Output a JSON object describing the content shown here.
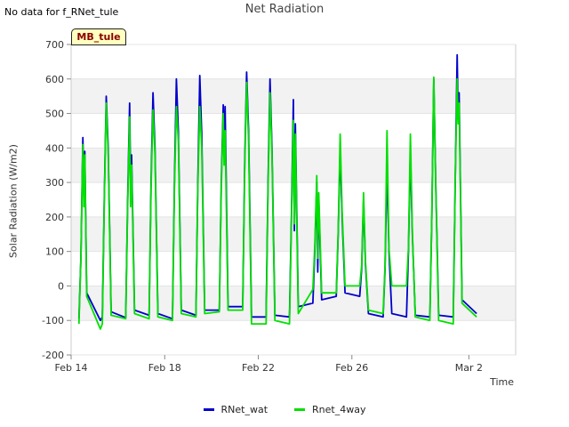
{
  "note": "No data for f_RNet_tule",
  "station_label": "MB_tule",
  "chart_data": {
    "type": "line",
    "title": "Net Radiation",
    "xlabel": "Time",
    "ylabel": "Solar Radiation (W/m2)",
    "xlim": [
      "2024-02-14",
      "2024-03-04"
    ],
    "ylim": [
      -200,
      700
    ],
    "x_ticks": [
      "Feb 14",
      "Feb 18",
      "Feb 22",
      "Feb 26",
      "Mar 2"
    ],
    "y_ticks": [
      -200,
      -100,
      0,
      100,
      200,
      300,
      400,
      500,
      600,
      700
    ],
    "grid": true,
    "legend_position": "bottom",
    "series": [
      {
        "name": "RNet_wat",
        "color": "#0000cc",
        "points": [
          [
            "2024-02-14T08:00",
            -95
          ],
          [
            "2024-02-14T10:00",
            80
          ],
          [
            "2024-02-14T12:00",
            430
          ],
          [
            "2024-02-14T13:00",
            300
          ],
          [
            "2024-02-14T14:00",
            390
          ],
          [
            "2024-02-14T16:00",
            -20
          ],
          [
            "2024-02-15T06:00",
            -100
          ],
          [
            "2024-02-15T08:00",
            -90
          ],
          [
            "2024-02-15T10:00",
            250
          ],
          [
            "2024-02-15T12:00",
            550
          ],
          [
            "2024-02-15T14:00",
            400
          ],
          [
            "2024-02-15T17:00",
            -75
          ],
          [
            "2024-02-16T08:00",
            -92
          ],
          [
            "2024-02-16T10:00",
            250
          ],
          [
            "2024-02-16T12:00",
            530
          ],
          [
            "2024-02-16T13:00",
            300
          ],
          [
            "2024-02-16T14:00",
            380
          ],
          [
            "2024-02-16T17:00",
            -70
          ],
          [
            "2024-02-17T08:00",
            -85
          ],
          [
            "2024-02-17T10:00",
            300
          ],
          [
            "2024-02-17T12:00",
            560
          ],
          [
            "2024-02-17T14:00",
            400
          ],
          [
            "2024-02-17T17:00",
            -80
          ],
          [
            "2024-02-18T08:00",
            -95
          ],
          [
            "2024-02-18T10:00",
            300
          ],
          [
            "2024-02-18T12:00",
            600
          ],
          [
            "2024-02-18T14:00",
            450
          ],
          [
            "2024-02-18T17:00",
            -70
          ],
          [
            "2024-02-19T08:00",
            -85
          ],
          [
            "2024-02-19T10:00",
            300
          ],
          [
            "2024-02-19T12:00",
            610
          ],
          [
            "2024-02-19T14:00",
            440
          ],
          [
            "2024-02-19T17:00",
            -70
          ],
          [
            "2024-02-20T08:00",
            -70
          ],
          [
            "2024-02-20T10:00",
            300
          ],
          [
            "2024-02-20T12:00",
            525
          ],
          [
            "2024-02-20T13:00",
            400
          ],
          [
            "2024-02-20T14:00",
            520
          ],
          [
            "2024-02-20T17:00",
            -60
          ],
          [
            "2024-02-21T08:00",
            -60
          ],
          [
            "2024-02-21T10:00",
            350
          ],
          [
            "2024-02-21T12:00",
            620
          ],
          [
            "2024-02-21T14:00",
            450
          ],
          [
            "2024-02-21T17:00",
            -90
          ],
          [
            "2024-02-22T08:00",
            -90
          ],
          [
            "2024-02-22T10:00",
            300
          ],
          [
            "2024-02-22T12:00",
            600
          ],
          [
            "2024-02-22T14:00",
            400
          ],
          [
            "2024-02-22T17:00",
            -85
          ],
          [
            "2024-02-23T08:00",
            -90
          ],
          [
            "2024-02-23T10:00",
            200
          ],
          [
            "2024-02-23T12:00",
            540
          ],
          [
            "2024-02-23T13:00",
            160
          ],
          [
            "2024-02-23T14:00",
            470
          ],
          [
            "2024-02-23T17:00",
            -60
          ],
          [
            "2024-02-24T08:00",
            -50
          ],
          [
            "2024-02-24T10:00",
            100
          ],
          [
            "2024-02-24T12:00",
            300
          ],
          [
            "2024-02-24T13:00",
            40
          ],
          [
            "2024-02-24T14:00",
            250
          ],
          [
            "2024-02-24T17:00",
            -40
          ],
          [
            "2024-02-25T08:00",
            -30
          ],
          [
            "2024-02-25T10:00",
            150
          ],
          [
            "2024-02-25T12:00",
            400
          ],
          [
            "2024-02-25T14:00",
            200
          ],
          [
            "2024-02-25T17:00",
            -20
          ],
          [
            "2024-02-26T08:00",
            -30
          ],
          [
            "2024-02-26T10:00",
            50
          ],
          [
            "2024-02-26T12:00",
            250
          ],
          [
            "2024-02-26T14:00",
            60
          ],
          [
            "2024-02-26T17:00",
            -80
          ],
          [
            "2024-02-27T08:00",
            -90
          ],
          [
            "2024-02-27T10:00",
            50
          ],
          [
            "2024-02-27T12:00",
            350
          ],
          [
            "2024-02-27T14:00",
            100
          ],
          [
            "2024-02-27T17:00",
            -80
          ],
          [
            "2024-02-28T08:00",
            -90
          ],
          [
            "2024-02-28T10:00",
            100
          ],
          [
            "2024-02-28T12:00",
            390
          ],
          [
            "2024-02-28T14:00",
            150
          ],
          [
            "2024-02-28T17:00",
            -85
          ],
          [
            "2024-02-29T08:00",
            -90
          ],
          [
            "2024-02-29T10:00",
            200
          ],
          [
            "2024-02-29T12:00",
            600
          ],
          [
            "2024-02-29T14:00",
            300
          ],
          [
            "2024-02-29T17:00",
            -85
          ],
          [
            "2024-03-01T08:00",
            -90
          ],
          [
            "2024-03-01T10:00",
            300
          ],
          [
            "2024-03-01T12:00",
            670
          ],
          [
            "2024-03-01T13:00",
            500
          ],
          [
            "2024-03-01T14:00",
            560
          ],
          [
            "2024-03-01T17:00",
            -40
          ],
          [
            "2024-03-02T08:00",
            -80
          ]
        ]
      },
      {
        "name": "Rnet_4way",
        "color": "#00e000",
        "points": [
          [
            "2024-02-14T08:00",
            -110
          ],
          [
            "2024-02-14T10:00",
            80
          ],
          [
            "2024-02-14T12:00",
            410
          ],
          [
            "2024-02-14T13:00",
            230
          ],
          [
            "2024-02-14T14:00",
            380
          ],
          [
            "2024-02-14T16:00",
            -30
          ],
          [
            "2024-02-15T06:00",
            -125
          ],
          [
            "2024-02-15T08:00",
            -110
          ],
          [
            "2024-02-15T10:00",
            240
          ],
          [
            "2024-02-15T12:00",
            530
          ],
          [
            "2024-02-15T14:00",
            380
          ],
          [
            "2024-02-15T17:00",
            -85
          ],
          [
            "2024-02-16T08:00",
            -95
          ],
          [
            "2024-02-16T10:00",
            230
          ],
          [
            "2024-02-16T12:00",
            490
          ],
          [
            "2024-02-16T13:00",
            230
          ],
          [
            "2024-02-16T14:00",
            350
          ],
          [
            "2024-02-16T17:00",
            -80
          ],
          [
            "2024-02-17T08:00",
            -95
          ],
          [
            "2024-02-17T10:00",
            280
          ],
          [
            "2024-02-17T12:00",
            510
          ],
          [
            "2024-02-17T14:00",
            380
          ],
          [
            "2024-02-17T17:00",
            -90
          ],
          [
            "2024-02-18T08:00",
            -100
          ],
          [
            "2024-02-18T10:00",
            280
          ],
          [
            "2024-02-18T12:00",
            520
          ],
          [
            "2024-02-18T14:00",
            420
          ],
          [
            "2024-02-18T17:00",
            -80
          ],
          [
            "2024-02-19T08:00",
            -90
          ],
          [
            "2024-02-19T10:00",
            280
          ],
          [
            "2024-02-19T12:00",
            520
          ],
          [
            "2024-02-19T14:00",
            400
          ],
          [
            "2024-02-19T17:00",
            -80
          ],
          [
            "2024-02-20T08:00",
            -75
          ],
          [
            "2024-02-20T10:00",
            280
          ],
          [
            "2024-02-20T12:00",
            500
          ],
          [
            "2024-02-20T13:00",
            350
          ],
          [
            "2024-02-20T14:00",
            450
          ],
          [
            "2024-02-20T17:00",
            -70
          ],
          [
            "2024-02-21T08:00",
            -70
          ],
          [
            "2024-02-21T10:00",
            330
          ],
          [
            "2024-02-21T12:00",
            590
          ],
          [
            "2024-02-21T14:00",
            420
          ],
          [
            "2024-02-21T17:00",
            -110
          ],
          [
            "2024-02-22T08:00",
            -110
          ],
          [
            "2024-02-22T10:00",
            280
          ],
          [
            "2024-02-22T12:00",
            560
          ],
          [
            "2024-02-22T14:00",
            380
          ],
          [
            "2024-02-22T17:00",
            -100
          ],
          [
            "2024-02-23T08:00",
            -110
          ],
          [
            "2024-02-23T10:00",
            180
          ],
          [
            "2024-02-23T12:00",
            480
          ],
          [
            "2024-02-23T13:00",
            180
          ],
          [
            "2024-02-23T14:00",
            440
          ],
          [
            "2024-02-23T17:00",
            -80
          ],
          [
            "2024-02-24T08:00",
            -10
          ],
          [
            "2024-02-24T10:00",
            120
          ],
          [
            "2024-02-24T12:00",
            320
          ],
          [
            "2024-02-24T13:00",
            80
          ],
          [
            "2024-02-24T14:00",
            270
          ],
          [
            "2024-02-24T17:00",
            -20
          ],
          [
            "2024-02-25T08:00",
            -20
          ],
          [
            "2024-02-25T10:00",
            160
          ],
          [
            "2024-02-25T12:00",
            440
          ],
          [
            "2024-02-25T14:00",
            220
          ],
          [
            "2024-02-25T17:00",
            0
          ],
          [
            "2024-02-26T08:00",
            0
          ],
          [
            "2024-02-26T10:00",
            60
          ],
          [
            "2024-02-26T12:00",
            270
          ],
          [
            "2024-02-26T14:00",
            70
          ],
          [
            "2024-02-26T17:00",
            -70
          ],
          [
            "2024-02-27T08:00",
            -80
          ],
          [
            "2024-02-27T10:00",
            60
          ],
          [
            "2024-02-27T12:00",
            450
          ],
          [
            "2024-02-27T14:00",
            110
          ],
          [
            "2024-02-27T17:00",
            0
          ],
          [
            "2024-02-28T08:00",
            0
          ],
          [
            "2024-02-28T10:00",
            110
          ],
          [
            "2024-02-28T12:00",
            440
          ],
          [
            "2024-02-28T14:00",
            160
          ],
          [
            "2024-02-28T17:00",
            -90
          ],
          [
            "2024-02-29T08:00",
            -100
          ],
          [
            "2024-02-29T10:00",
            200
          ],
          [
            "2024-02-29T12:00",
            605
          ],
          [
            "2024-02-29T14:00",
            290
          ],
          [
            "2024-02-29T17:00",
            -100
          ],
          [
            "2024-03-01T08:00",
            -110
          ],
          [
            "2024-03-01T10:00",
            300
          ],
          [
            "2024-03-01T12:00",
            600
          ],
          [
            "2024-03-01T13:00",
            470
          ],
          [
            "2024-03-01T14:00",
            530
          ],
          [
            "2024-03-01T17:00",
            -50
          ],
          [
            "2024-03-02T08:00",
            -90
          ]
        ]
      }
    ]
  }
}
